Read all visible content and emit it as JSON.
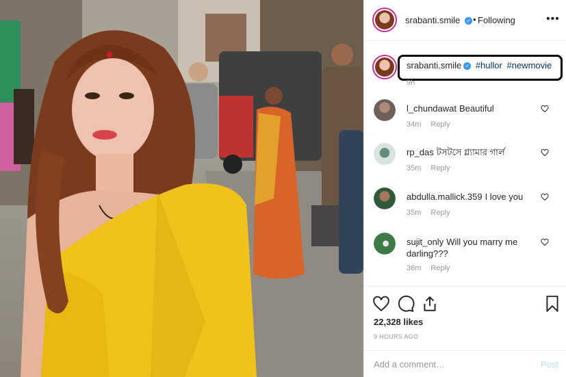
{
  "header": {
    "username": "srabanti.smile",
    "separator": "•",
    "follow_status": "Following",
    "more_label": "•••"
  },
  "caption": {
    "username": "srabanti.smile",
    "hashtags": [
      "#hullor",
      "#newmovie"
    ],
    "time": "9h"
  },
  "comments": [
    {
      "username": "l_chundawat",
      "text": "Beautiful",
      "time": "34m",
      "reply": "Reply"
    },
    {
      "username": "rp_das",
      "text": "টসটসে গ্ল্যামার গার্ল",
      "time": "35m",
      "reply": "Reply"
    },
    {
      "username": "abdulla.mallick.359",
      "text": "I love you",
      "time": "35m",
      "reply": "Reply"
    },
    {
      "username": "sujit_only",
      "text": "Will you marry me darling???",
      "time": "36m",
      "reply": "Reply"
    }
  ],
  "stats": {
    "likes": "22,328 likes",
    "posted_ago": "9 HOURS AGO"
  },
  "add_comment": {
    "placeholder": "Add a comment…",
    "post_label": "Post"
  },
  "icons": [
    "heart-icon",
    "comment-icon",
    "share-icon",
    "bookmark-icon",
    "verified-badge-icon",
    "more-options-icon"
  ],
  "colors": {
    "verified_blue": "#3897f0",
    "hashtag_blue": "#003569",
    "meta_gray": "#999999",
    "post_disabled": "#b2dffc",
    "highlight_box": "#000000"
  }
}
